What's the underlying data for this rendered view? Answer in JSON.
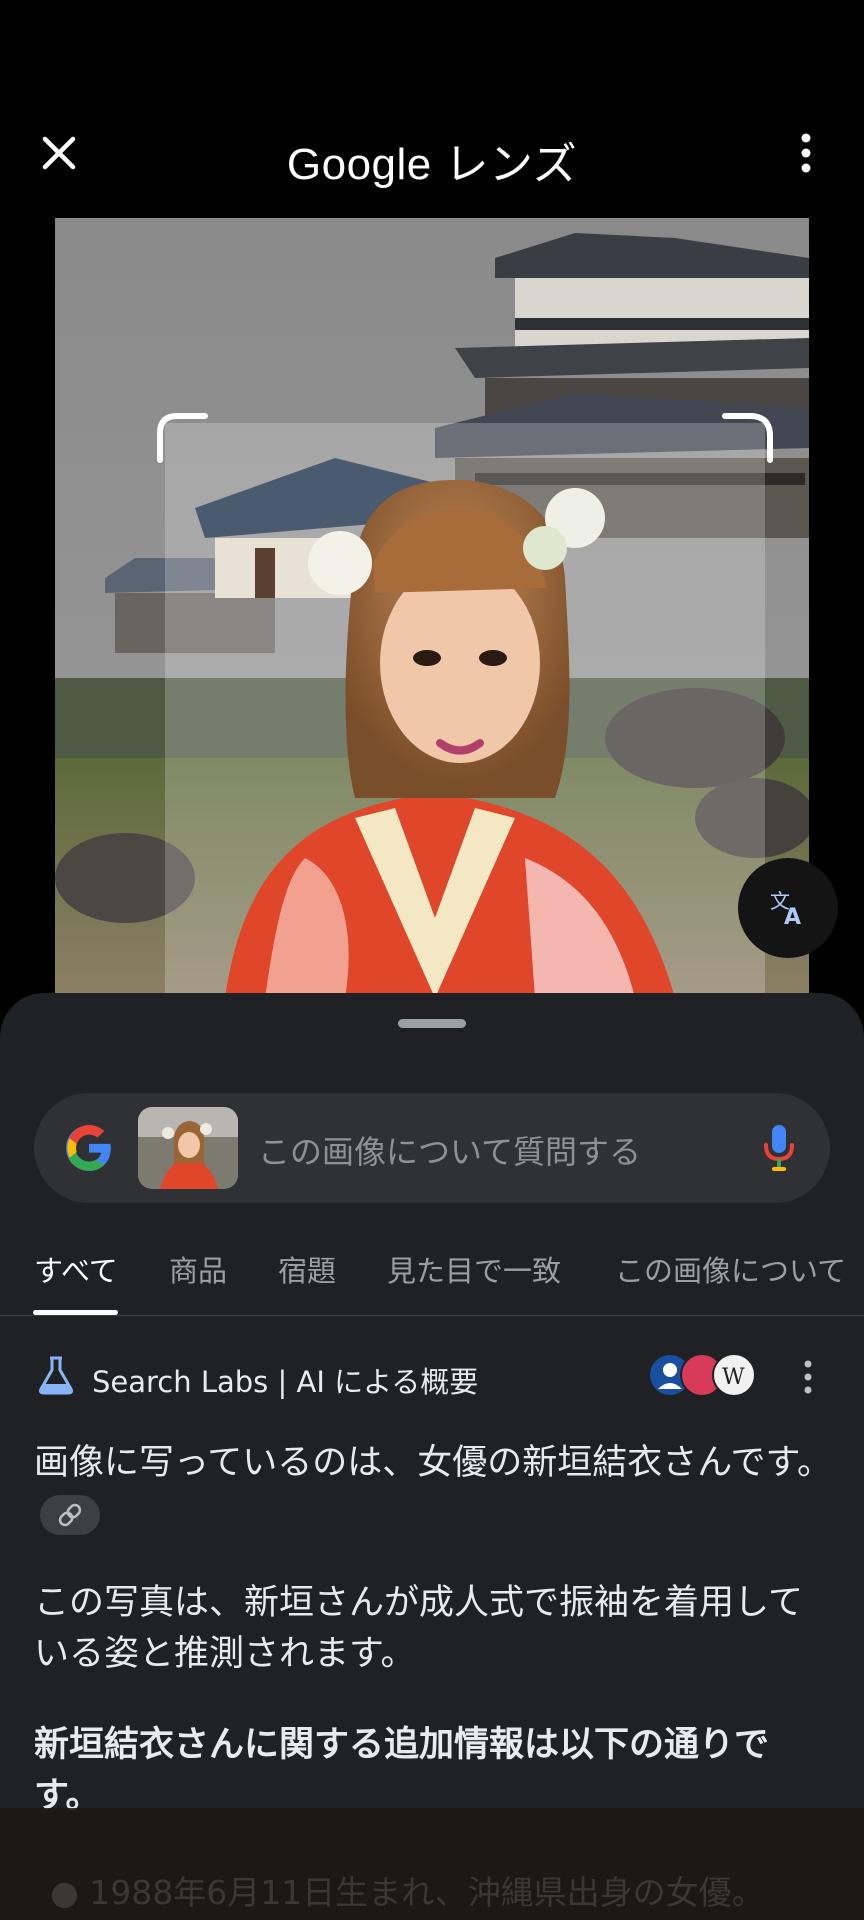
{
  "app": {
    "title_brand": "Google",
    "title_suffix": "レンズ"
  },
  "search": {
    "placeholder": "この画像について質問する"
  },
  "tabs": [
    {
      "label": "すべて",
      "active": true
    },
    {
      "label": "商品",
      "active": false
    },
    {
      "label": "宿題",
      "active": false
    },
    {
      "label": "見た目で一致",
      "active": false
    },
    {
      "label": "この画像について",
      "active": false
    }
  ],
  "ai_overview": {
    "title": "Search Labs | AI による概要",
    "paragraph1": "画像に写っているのは、女優の新垣結衣さんです。",
    "paragraph2": "この写真は、新垣さんが成人式で振袖を着用している姿と推測されます。",
    "paragraph3": "新垣結衣さんに関する追加情報は以下の通りです。",
    "bullet1": "1988年6月11日生まれ、沖縄県出身の女優。"
  },
  "icons": {
    "close": "close-icon",
    "menu": "more-vert-icon",
    "translate": "translate-icon",
    "google": "google-g-icon",
    "mic": "mic-icon",
    "labs": "flask-icon",
    "link": "link-icon"
  },
  "colors": {
    "background": "#000000",
    "sheet": "#202124",
    "search_bar": "#303134",
    "text_primary": "#e8eaed",
    "text_secondary": "#9aa0a6",
    "accent_blue": "#4285f4"
  }
}
